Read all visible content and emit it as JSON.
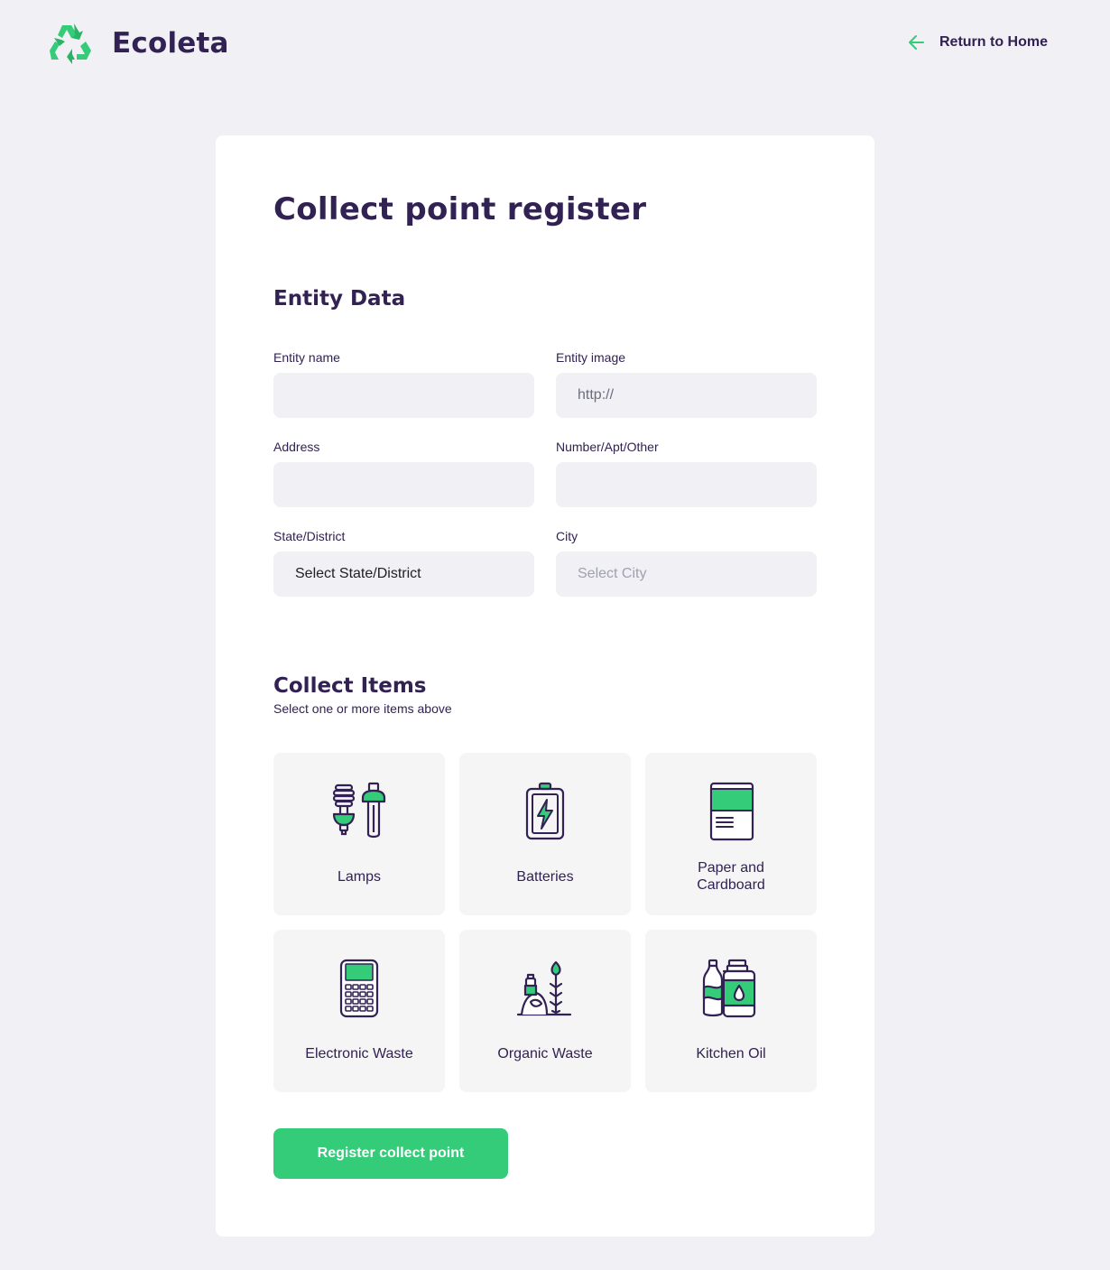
{
  "header": {
    "brand": "Ecoleta",
    "back_link": "Return to Home"
  },
  "form": {
    "title": "Collect point register",
    "entity_section": {
      "title": "Entity Data",
      "fields": {
        "name_label": "Entity name",
        "name_value": "",
        "image_label": "Entity image",
        "image_placeholder": "http://",
        "address_label": "Address",
        "address_value": "",
        "number_label": "Number/Apt/Other",
        "number_value": "",
        "state_label": "State/District",
        "state_selected": "Select State/District",
        "city_label": "City",
        "city_selected": "Select City"
      }
    },
    "items_section": {
      "title": "Collect Items",
      "subtitle": "Select one or more items above",
      "items": [
        {
          "label": "Lamps",
          "icon": "lamps-icon"
        },
        {
          "label": "Batteries",
          "icon": "battery-icon"
        },
        {
          "label": "Paper and",
          "label2": "Cardboard",
          "icon": "paper-icon"
        },
        {
          "label": "Electronic Waste",
          "icon": "electronic-icon"
        },
        {
          "label": "Organic Waste",
          "icon": "organic-icon"
        },
        {
          "label": "Kitchen Oil",
          "icon": "oil-icon"
        }
      ]
    },
    "submit_label": "Register collect point"
  },
  "colors": {
    "accent": "#34CB79",
    "text": "#322153",
    "background": "#F0F0F5"
  }
}
